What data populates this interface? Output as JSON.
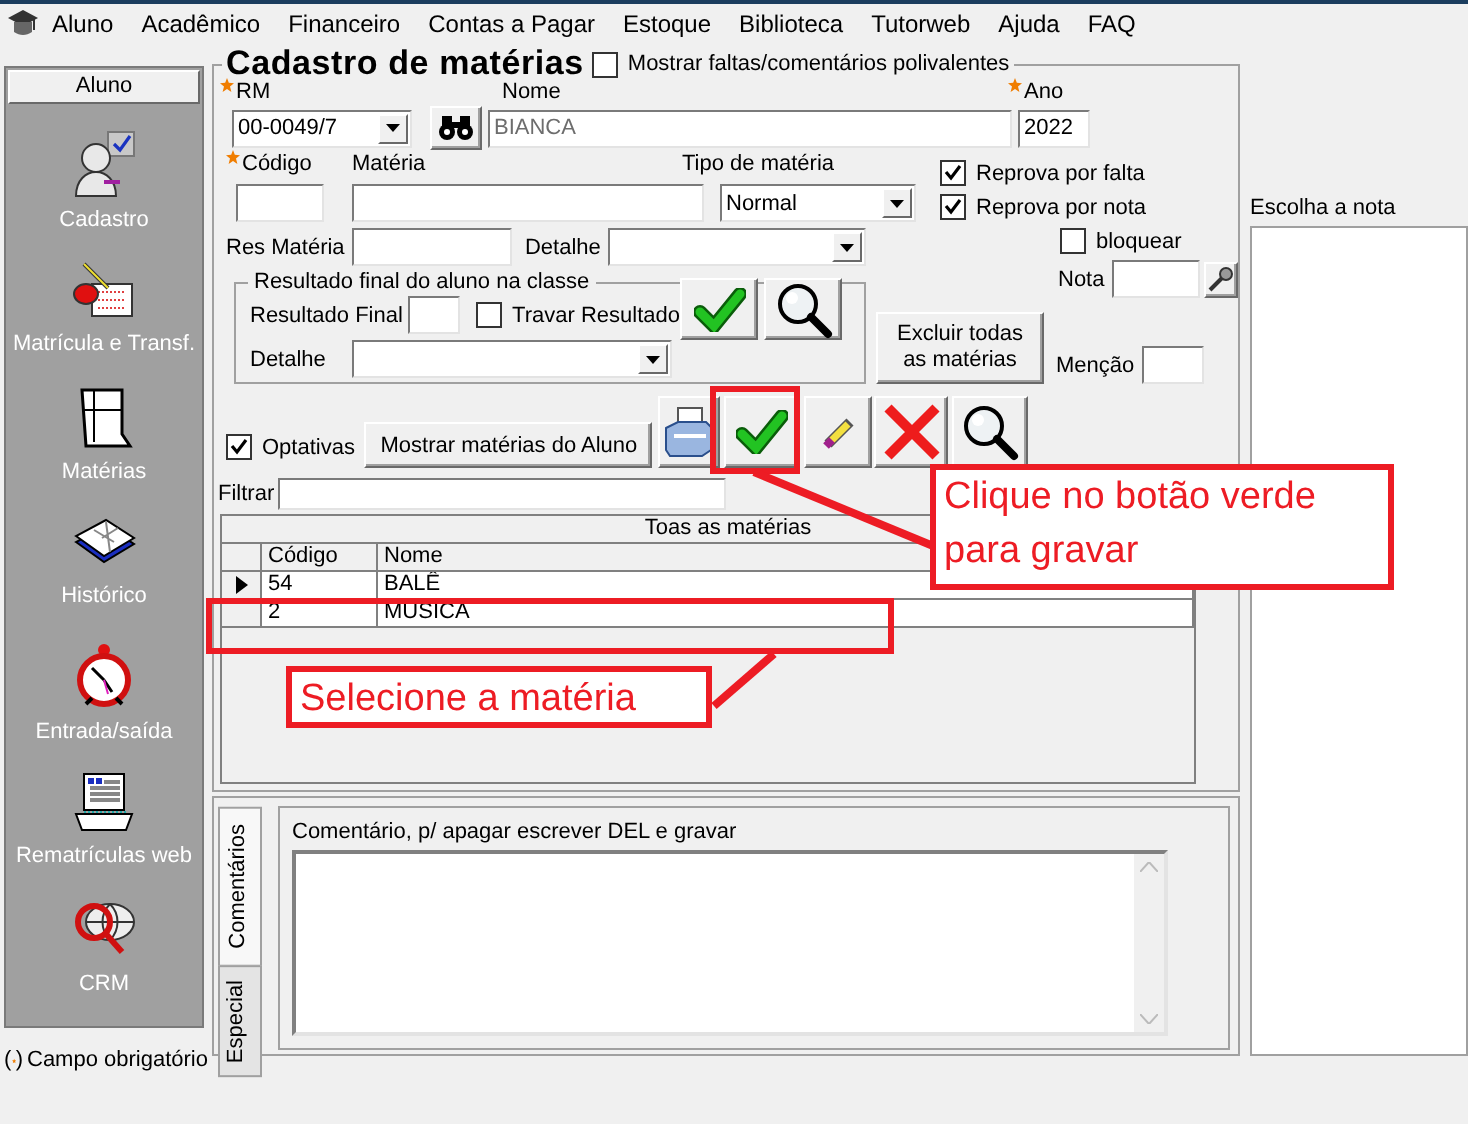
{
  "menu": [
    "Aluno",
    "Acadêmico",
    "Financeiro",
    "Contas a Pagar",
    "Estoque",
    "Biblioteca",
    "Tutorweb",
    "Ajuda",
    "FAQ"
  ],
  "sidebar": {
    "header": "Aluno",
    "items": [
      {
        "label": "Cadastro",
        "kind": "person"
      },
      {
        "label": "Matrícula e Transf.",
        "kind": "enroll"
      },
      {
        "label": "Matérias",
        "kind": "binder"
      },
      {
        "label": "Histórico",
        "kind": "book"
      },
      {
        "label": "Entrada/saída",
        "kind": "clock"
      },
      {
        "label": "Rematrículas web",
        "kind": "computer"
      },
      {
        "label": "CRM",
        "kind": "globe"
      }
    ]
  },
  "legend": {
    "open": "(",
    "close": ")",
    "text": "Campo obrigatório"
  },
  "form": {
    "title": "Cadastro de matérias",
    "show_polyvalent": {
      "label": "Mostrar faltas/comentários polivalentes",
      "checked": false
    },
    "rm": {
      "label": "RM",
      "value": "00-0049/7",
      "required": true
    },
    "nome": {
      "label": "Nome",
      "value": "BIANCA",
      "disabled": true
    },
    "ano": {
      "label": "Ano",
      "value": "2022",
      "required": true
    },
    "codigo": {
      "label": "Código",
      "required": true
    },
    "materia": {
      "label": "Matéria"
    },
    "tipo": {
      "label": "Tipo de matéria",
      "value": "Normal"
    },
    "reprova_falta": {
      "label": "Reprova por falta",
      "checked": true
    },
    "reprova_nota": {
      "label": "Reprova por nota",
      "checked": true
    },
    "res_materia": {
      "label": "Res Matéria"
    },
    "detalhe": {
      "label": "Detalhe"
    },
    "bloquear": {
      "label": "bloquear",
      "checked": false
    },
    "nota": {
      "label": "Nota"
    },
    "resultado": {
      "title": "Resultado final do aluno na classe",
      "final_label": "Resultado Final",
      "travar": {
        "label": "Travar Resultado",
        "checked": false
      },
      "detalhe_label": "Detalhe"
    },
    "excluir_button": "Excluir todas as matérias",
    "mencao": {
      "label": "Menção"
    },
    "optativas": {
      "label": "Optativas",
      "checked": true
    },
    "show_button": "Mostrar matérias do Aluno",
    "filter": {
      "label": "Filtrar"
    }
  },
  "grid": {
    "title": "Toas as matérias",
    "columns": [
      "Código",
      "Nome"
    ],
    "rows": [
      {
        "cells": [
          "54",
          "BALÊ"
        ],
        "selected": true
      },
      {
        "cells": [
          "2",
          "MÚSICA"
        ],
        "selected": false
      }
    ]
  },
  "comments": {
    "tabs": [
      {
        "label": "Comentários",
        "selected": true
      },
      {
        "label": "Especial",
        "selected": false
      }
    ],
    "label": "Comentário, p/ apagar escrever DEL e gravar"
  },
  "grade_panel": {
    "label": "Escolha a nota"
  },
  "annotations": [
    {
      "text": "Clique no botão verde para gravar"
    },
    {
      "text": "Selecione a matéria"
    }
  ]
}
